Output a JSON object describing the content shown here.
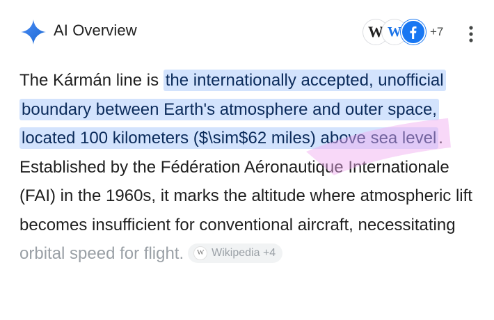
{
  "header": {
    "title": "AI Overview",
    "sparkle_icon": "gemini-sparkle-icon",
    "sources": [
      {
        "icon": "wikipedia-icon",
        "glyph": "W"
      },
      {
        "icon": "wiki-source-icon",
        "glyph": "W"
      },
      {
        "icon": "facebook-icon",
        "glyph": "f"
      }
    ],
    "more_sources": "+7",
    "menu_icon": "more-vert-icon"
  },
  "overview": {
    "intro": "The Kármán line is ",
    "highlight": "the internationally accepted, unofficial boundary between Earth's atmosphere and outer space, located 100 kilometers ($\\sim$62 miles) above sea level",
    "continuation": ". Established by the Fédération Aéronautique Internationale (FAI) in the 1960s, it marks the altitude where atmospheric lift becomes insufficient for conventional aircraft, necessitating ",
    "faded": "orbital speed for flight.",
    "citation": {
      "icon": "wikipedia-icon",
      "glyph": "W",
      "label": "Wikipedia +4"
    }
  },
  "colors": {
    "highlight_bg": "#d3e3fd",
    "highlight_text": "#0b2b5b",
    "sparkle_blue": "#4285f4",
    "annotation_pink": "#f0a8f0"
  }
}
